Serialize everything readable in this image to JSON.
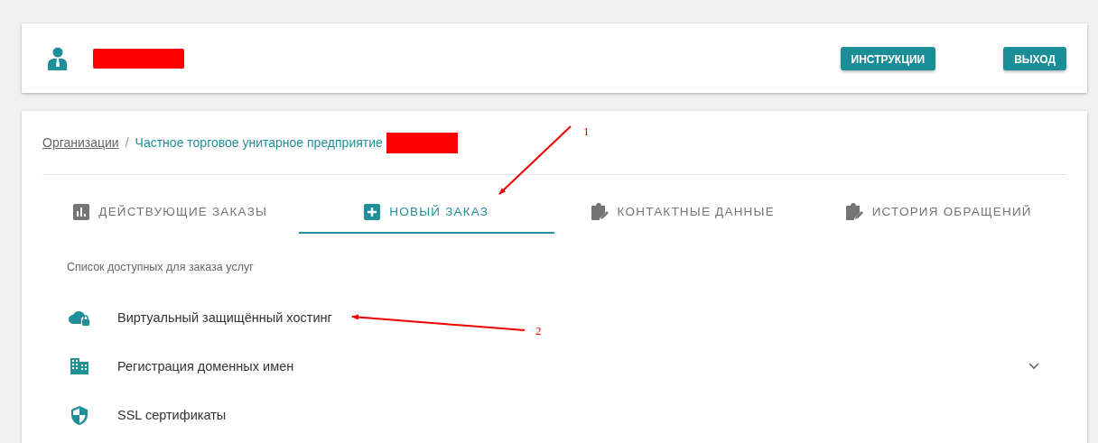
{
  "header": {
    "user_name_redacted": true,
    "buttons": [
      {
        "label": "ИНСТРУКЦИИ"
      },
      {
        "label": "ВЫХОД"
      }
    ]
  },
  "breadcrumb": {
    "items": [
      {
        "label": "Организации",
        "kind": "link"
      },
      {
        "label": "Частное торговое унитарное предприятие",
        "kind": "current"
      }
    ],
    "separator": "/",
    "name_redacted": true
  },
  "tabs": [
    {
      "label": "ДЕЙСТВУЮЩИЕ ЗАКАЗЫ",
      "selected": false
    },
    {
      "label": "НОВЫЙ ЗАКАЗ",
      "selected": true
    },
    {
      "label": "КОНТАКТНЫЕ ДАННЫЕ",
      "selected": false
    },
    {
      "label": "ИСТОРИЯ ОБРАЩЕНИЙ",
      "selected": false
    }
  ],
  "services": {
    "title": "Список доступных для заказа услуг",
    "items": [
      {
        "label": "Виртуальный защищённый хостинг",
        "kind": "plain"
      },
      {
        "label": "Регистрация доменных имен",
        "kind": "group"
      },
      {
        "label": "SSL сертификаты",
        "kind": "plain"
      }
    ]
  },
  "annotations": [
    {
      "label": "1"
    },
    {
      "label": "2"
    }
  ]
}
